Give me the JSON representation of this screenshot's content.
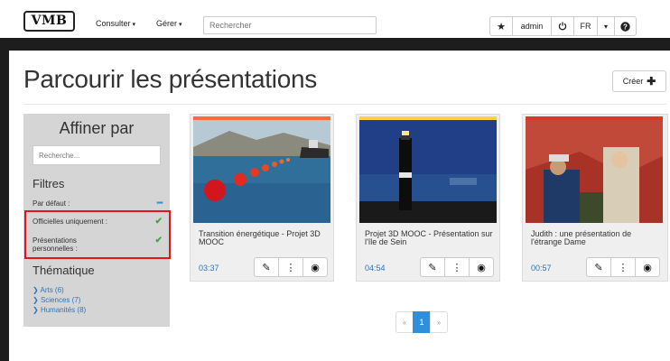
{
  "navbar": {
    "logo": "VMB",
    "consult_label": "Consulter",
    "manage_label": "Gérer",
    "search_placeholder": "Rechercher",
    "user_label": "admin",
    "language_label": "FR"
  },
  "page": {
    "title": "Parcourir les présentations",
    "create_label": "Créer"
  },
  "sidebar": {
    "title": "Affiner par",
    "search_placeholder": "Recherche...",
    "filters_heading": "Filtres",
    "filters": [
      {
        "label": "Par défaut :",
        "state": "minus"
      },
      {
        "label": "Officielles uniquement :",
        "state": "check"
      },
      {
        "label": "Présentations personnelles :",
        "state": "check"
      }
    ],
    "themes_heading": "Thématique",
    "themes": [
      {
        "label": "Arts (6)"
      },
      {
        "label": "Sciences (7)"
      },
      {
        "label": "Humanités (8)"
      }
    ]
  },
  "cards": [
    {
      "title": "Transition énergétique - Projet 3D MOOC",
      "duration": "03:37",
      "thumbnail": "sea-buoys-ship",
      "accent_color": "#ff6a3d"
    },
    {
      "title": "Projet 3D MOOC - Présentation sur l'île de Sein",
      "duration": "04:54",
      "thumbnail": "lighthouse-night",
      "accent_color": "#ffd23d"
    },
    {
      "title": "Judith : une présentation de l'étrange Dame",
      "duration": "00:57",
      "thumbnail": "painting-judith",
      "accent_color": "#d33a2a"
    }
  ],
  "pagination": {
    "prev": "«",
    "current": "1",
    "next": "»"
  },
  "colors": {
    "accent_blue": "#2f8fdb",
    "highlight_red": "#e4141b",
    "check_green": "#3aab3a"
  }
}
